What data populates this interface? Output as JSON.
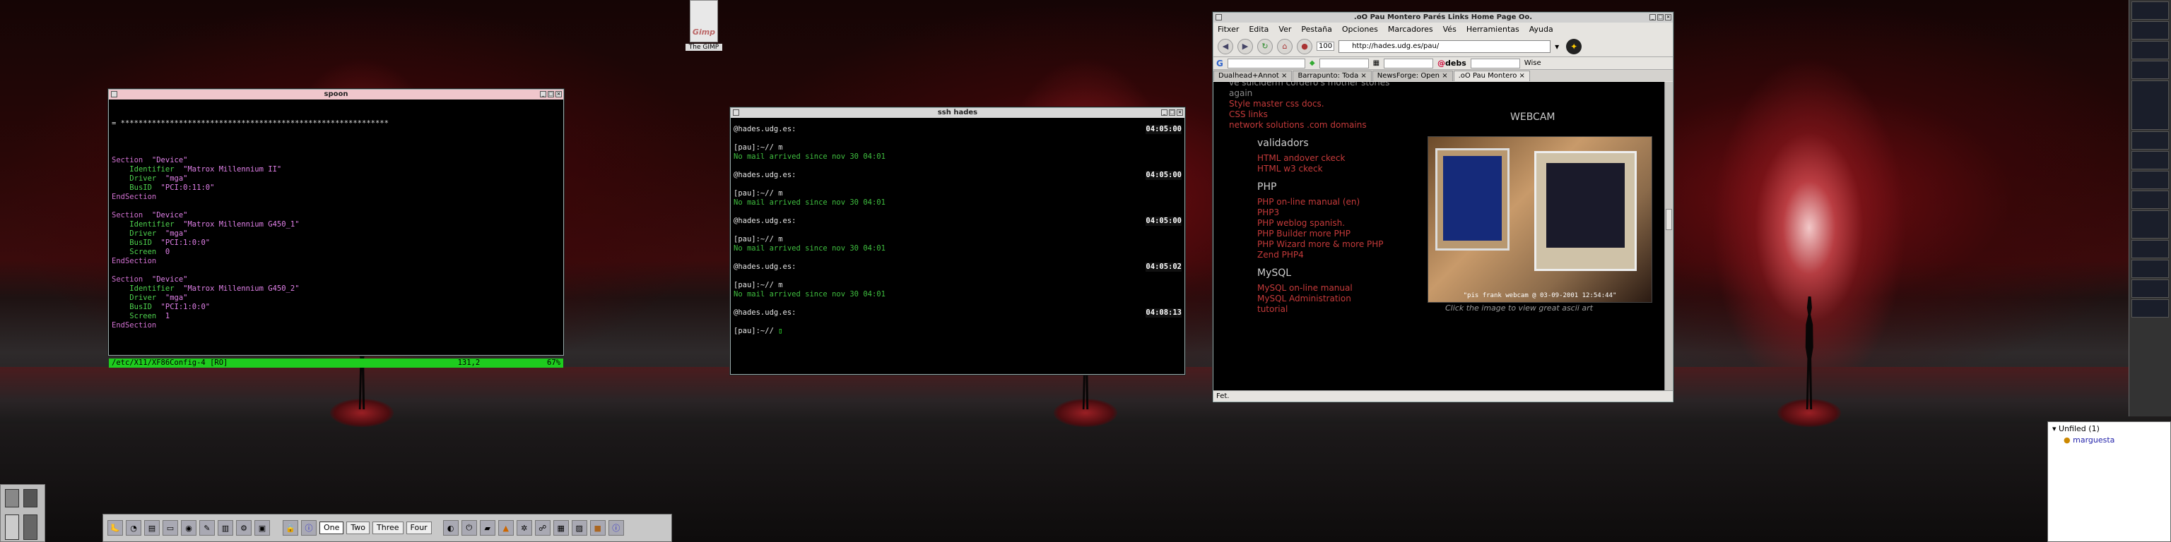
{
  "desktop": {
    "gimp_label": "The GIMP",
    "gimp_icon_text": "Gimp"
  },
  "vim_window": {
    "title": "spoon",
    "marker_line": "= ************************************************************",
    "lines": [
      {
        "kw": "Section",
        "val": "\"Device\"",
        "indent": 0
      },
      {
        "kw": "Identifier",
        "val": "\"Matrox Millennium II\"",
        "indent": 2
      },
      {
        "kw": "Driver",
        "val": "\"mga\"",
        "indent": 2
      },
      {
        "kw": "BusID",
        "val": "\"PCI:0:11:0\"",
        "indent": 2
      },
      {
        "kw": "EndSection",
        "val": "",
        "indent": 0
      },
      {
        "kw": "",
        "val": "",
        "indent": 0
      },
      {
        "kw": "Section",
        "val": "\"Device\"",
        "indent": 0
      },
      {
        "kw": "Identifier",
        "val": "\"Matrox Millennium G450_1\"",
        "indent": 2
      },
      {
        "kw": "Driver",
        "val": "\"mga\"",
        "indent": 2
      },
      {
        "kw": "BusID",
        "val": "\"PCI:1:0:0\"",
        "indent": 2
      },
      {
        "kw": "Screen",
        "val": "0",
        "indent": 2
      },
      {
        "kw": "EndSection",
        "val": "",
        "indent": 0
      },
      {
        "kw": "",
        "val": "",
        "indent": 0
      },
      {
        "kw": "Section",
        "val": "\"Device\"",
        "indent": 0
      },
      {
        "kw": "Identifier",
        "val": "\"Matrox Millennium G450_2\"",
        "indent": 2
      },
      {
        "kw": "Driver",
        "val": "\"mga\"",
        "indent": 2
      },
      {
        "kw": "BusID",
        "val": "\"PCI:1:0:0\"",
        "indent": 2
      },
      {
        "kw": "Screen",
        "val": "1",
        "indent": 2
      },
      {
        "kw": "EndSection",
        "val": "",
        "indent": 0
      }
    ],
    "status_file": "/etc/X11/XF86Config-4 [RO]",
    "status_pos": "131,2",
    "status_pct": "67%"
  },
  "ssh_window": {
    "title": "ssh hades",
    "blocks": [
      {
        "host": "@hades.udg.es:",
        "time": "04:05:00",
        "prompt": "[pau]:~// m",
        "mail": "No mail arrived since nov 30 04:01"
      },
      {
        "host": "@hades.udg.es:",
        "time": "04:05:00",
        "prompt": "[pau]:~// m",
        "mail": "No mail arrived since nov 30 04:01"
      },
      {
        "host": "@hades.udg.es:",
        "time": "04:05:00",
        "prompt": "[pau]:~// m",
        "mail": "No mail arrived since nov 30 04:01"
      },
      {
        "host": "@hades.udg.es:",
        "time": "04:05:02",
        "prompt": "[pau]:~// m",
        "mail": "No mail arrived since nov 30 04:01"
      },
      {
        "host": "@hades.udg.es:",
        "time": "04:08:13",
        "prompt": "[pau]:~// ",
        "mail": ""
      }
    ]
  },
  "browser": {
    "title": ".oO Pau Montero Parés Links Home Page Oo.",
    "menu": [
      "Fitxer",
      "Edita",
      "Ver",
      "Pestaña",
      "Opciones",
      "Marcadores",
      "Vés",
      "Herramientas",
      "Ayuda"
    ],
    "zoom": "100",
    "url": "http://hades.udg.es/pau/",
    "bookmark_g": "G",
    "bookmark_debs": "debs",
    "bookmark_wise": "Wise",
    "tabs": [
      "Dualhead+Annot",
      "Barrapunto: Toda",
      "NewsForge: Open",
      ".oO Pau Montero"
    ],
    "active_tab": 3,
    "top_links": [
      "again",
      "Style master css docs.",
      "CSS links",
      "network solutions .com domains"
    ],
    "top_partial": "ve suiciderm cordero's mother stories",
    "sections": [
      {
        "heading": "validadors",
        "links": [
          "HTML andover ckeck",
          "HTML w3 ckeck"
        ]
      },
      {
        "heading": "PHP",
        "links": [
          "PHP on-line manual (en)",
          "PHP3",
          "PHP weblog spanish.",
          "PHP Builder more PHP",
          "PHP Wizard more & more PHP",
          "Zend PHP4"
        ]
      },
      {
        "heading": "MySQL",
        "links": [
          "MySQL on-line manual",
          "MySQL Administration",
          "tutorial"
        ]
      }
    ],
    "webcam_title": "WEBCAM",
    "webcam_caption": "\"pis frank webcam @ 03-09-2001 12:54:44\"",
    "webcam_note": "Click the image to view great ascii art",
    "status": "Fet."
  },
  "panel": {
    "workspaces": [
      "One",
      "Two",
      "Three",
      "Four"
    ],
    "active_workspace": 0
  },
  "buddy_list": {
    "group": "Unfiled (1)",
    "buddy": "marguesta"
  }
}
